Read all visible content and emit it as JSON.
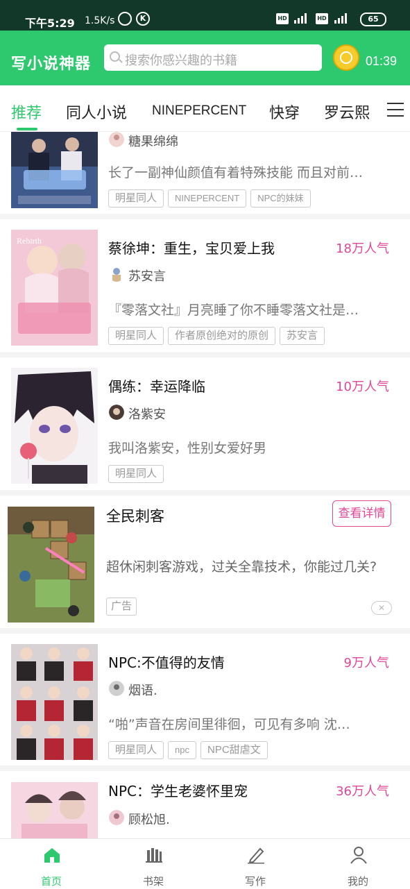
{
  "status_bar": {
    "time": "下午5:29",
    "net_speed": "1.5K/s",
    "hd1": "HD",
    "hd2": "HD",
    "battery": "65"
  },
  "header": {
    "app_title": "写小说神器",
    "search_placeholder": "搜索你感兴趣的书籍",
    "timer": "01:39"
  },
  "tabs": [
    "推荐",
    "同人小说",
    "NINEPERCENT",
    "快穿",
    "罗云熙"
  ],
  "books": [
    {
      "author": "糖果绵绵",
      "intro": "长了一副神仙颜值有着特殊技能 而且对前…",
      "tags": [
        "明星同人",
        "NINEPERCENT",
        "NPC的妹妹"
      ]
    },
    {
      "title": "蔡徐坤：重生，宝贝爱上我",
      "popularity": "18万人气",
      "author": "苏安言",
      "intro": "『零落文社』月亮睡了你不睡零落文社是…",
      "tags": [
        "明星同人",
        "作者原创绝对的原创",
        "苏安言"
      ]
    },
    {
      "title": "偶练：幸运降临",
      "popularity": "10万人气",
      "author": "洛紫安",
      "intro": "我叫洛紫安，性别女爱好男",
      "tags": [
        "明星同人"
      ]
    },
    {
      "title": "NPC:不值得的友情",
      "popularity": "9万人气",
      "author": "烟语.",
      "intro": "“啪”声音在房间里徘徊，可见有多响 沈…",
      "tags": [
        "明星同人",
        "npc",
        "NPC甜虐文"
      ]
    },
    {
      "title": "NPC：学生老婆怀里宠",
      "popularity": "36万人气",
      "author": "顾松旭."
    }
  ],
  "ad": {
    "title": "全民刺客",
    "button": "查看详情",
    "desc": "超休闲刺客游戏，过关全靠技术，你能过几关?",
    "tag": "广告",
    "close": "✕"
  },
  "bottom_nav": [
    {
      "label": "首页",
      "icon": "home-icon"
    },
    {
      "label": "书架",
      "icon": "bookshelf-icon"
    },
    {
      "label": "写作",
      "icon": "pencil-icon"
    },
    {
      "label": "我的",
      "icon": "profile-icon"
    }
  ],
  "colors": {
    "accent": "#2ec96e",
    "status_bar": "#12382a",
    "popularity": "#e0479a"
  }
}
